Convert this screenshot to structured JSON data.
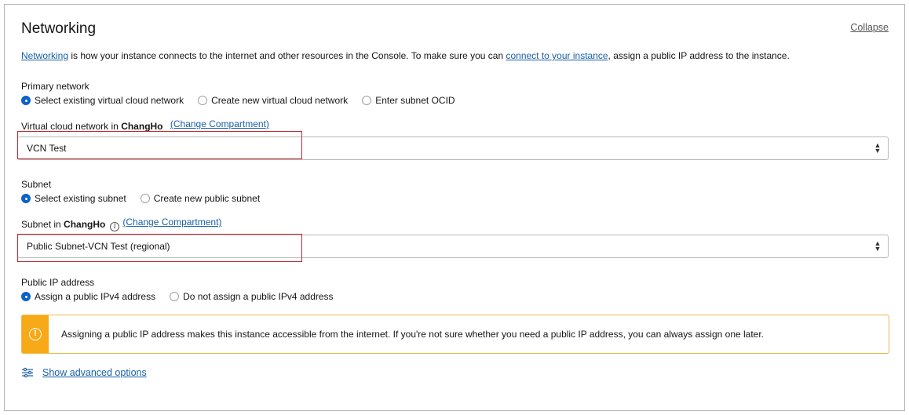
{
  "header": {
    "title": "Networking",
    "collapse_label": "Collapse"
  },
  "description": {
    "link1": "Networking",
    "text1": " is how your instance connects to the internet and other resources in the Console. To make sure you can ",
    "link2": "connect to your instance",
    "text2": ", assign a public IP address to the instance."
  },
  "primary_network": {
    "label": "Primary network",
    "options": [
      "Select existing virtual cloud network",
      "Create new virtual cloud network",
      "Enter subnet OCID"
    ],
    "selected_index": 0
  },
  "vcn": {
    "label_prefix": "Virtual cloud network in ",
    "compartment": "ChangHo",
    "change_label": "(Change Compartment)",
    "value": "VCN Test"
  },
  "subnet_choice": {
    "label": "Subnet",
    "options": [
      "Select existing subnet",
      "Create new public subnet"
    ],
    "selected_index": 0
  },
  "subnet": {
    "label_prefix": "Subnet in ",
    "compartment": "ChangHo",
    "info_glyph": "i",
    "change_label": "(Change Compartment)",
    "value": "Public Subnet-VCN Test (regional)"
  },
  "public_ip": {
    "label": "Public IP address",
    "options": [
      "Assign a public IPv4 address",
      "Do not assign a public IPv4 address"
    ],
    "selected_index": 0
  },
  "warning": {
    "icon_glyph": "!",
    "text": "Assigning a public IP address makes this instance accessible from the internet. If you're not sure whether you need a public IP address, you can always assign one later."
  },
  "advanced": {
    "label": "Show advanced options"
  },
  "colors": {
    "link": "#1a5fa8",
    "radio_selected": "#0b63c7",
    "highlight_box": "#c0282f",
    "warning_accent": "#f7a917"
  }
}
